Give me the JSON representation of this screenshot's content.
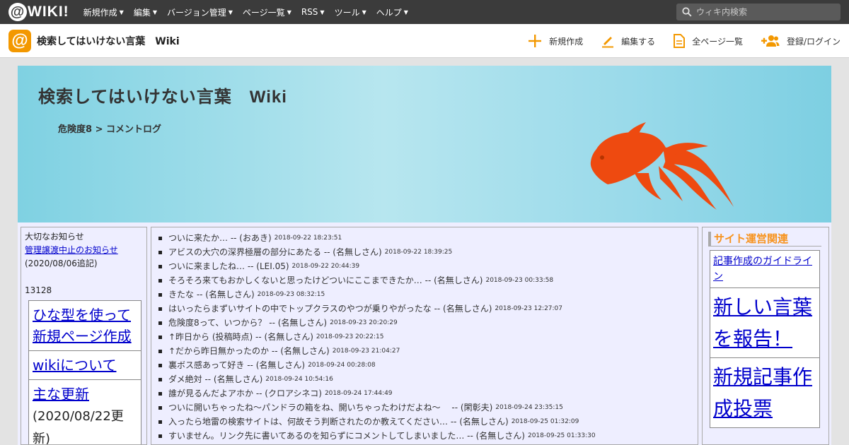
{
  "topbar": {
    "logo_text": "WIKI!",
    "menu": [
      {
        "label": "新規作成"
      },
      {
        "label": "編集"
      },
      {
        "label": "バージョン管理"
      },
      {
        "label": "ページ一覧"
      },
      {
        "label": "RSS"
      },
      {
        "label": "ツール"
      },
      {
        "label": "ヘルプ"
      }
    ],
    "search_placeholder": "ウィキ内検索"
  },
  "subbar": {
    "title": "検索してはいけない言葉　Wiki",
    "actions": {
      "new": "新規作成",
      "edit": "編集する",
      "all_pages": "全ページ一覧",
      "login": "登録/ログイン"
    }
  },
  "banner": {
    "title": "検索してはいけない言葉　Wiki",
    "breadcrumb": "危険度8 > コメントログ"
  },
  "left": {
    "notice_heading": "大切なお知らせ",
    "notice_link": "管理譲渡中止のお知らせ",
    "notice_date": "(2020/08/06追記)",
    "counter": "13128",
    "box": {
      "template_link": "ひな型を使って新規ページ作成",
      "about_link": "wikiについて",
      "updates_link": "主な更新",
      "updates_note": "(2020/08/22更新)"
    }
  },
  "comments": [
    {
      "text": "ついに来たか… -- (おあき)",
      "time": "2018-09-22 18:23:51"
    },
    {
      "text": "アビスの大穴の深界極層の部分にあたる -- (名無しさん)",
      "time": "2018-09-22 18:39:25"
    },
    {
      "text": "ついに来ましたね… -- (LEI.05)",
      "time": "2018-09-22 20:44:39"
    },
    {
      "text": "そろそろ来てもおかしくないと思ったけどついにここまできたか… -- (名無しさん)",
      "time": "2018-09-23 00:33:58"
    },
    {
      "text": "きたな -- (名無しさん)",
      "time": "2018-09-23 08:32:15"
    },
    {
      "text": "はいったらまずいサイトの中でトップクラスのやつが乗りやがったな -- (名無しさん)",
      "time": "2018-09-23 12:27:07"
    },
    {
      "text": "危険度8って、いつから？ -- (名無しさん)",
      "time": "2018-09-23 20:20:29"
    },
    {
      "text": "↑昨日から (投稿時点) -- (名無しさん)",
      "time": "2018-09-23 20:22:15"
    },
    {
      "text": "↑だから昨日無かったのか -- (名無しさん)",
      "time": "2018-09-23 21:04:27"
    },
    {
      "text": "裏ボス感あって好き -- (名無しさん)",
      "time": "2018-09-24 00:28:08"
    },
    {
      "text": "ダメ絶対 -- (名無しさん)",
      "time": "2018-09-24 10:54:16"
    },
    {
      "text": "誰が見るんだよアホか -- (クロアシネコ)",
      "time": "2018-09-24 17:44:49"
    },
    {
      "text": "ついに開いちゃったね～パンドラの箱をね、開いちゃったわけだよね～　 -- (閑彰夫)",
      "time": "2018-09-24 23:35:15"
    },
    {
      "text": "入ったら地雷の検索サイトは、何故そう判断されたのか教えてください… -- (名無しさん)",
      "time": "2018-09-25 01:32:09"
    },
    {
      "text": "すいません。リンク先に書いてあるのを知らずにコメントしてしまいました… -- (名無しさん)",
      "time": "2018-09-25 01:33:30"
    }
  ],
  "right": {
    "heading": "サイト運営関連",
    "guideline_link": "記事作成のガイドライン",
    "report_link": "新しい言葉を報告！",
    "vote_link": "新規記事作成投票"
  },
  "colors": {
    "topbar": "#3b3b3b",
    "accent": "#f39800",
    "goldfish": "#ee4a10",
    "link": "#0000cc",
    "heading_orange": "#f7931e"
  },
  "icons": [
    "search-icon",
    "plus-icon",
    "pencil-icon",
    "document-icon",
    "add-user-icon",
    "goldfish-logo"
  ]
}
